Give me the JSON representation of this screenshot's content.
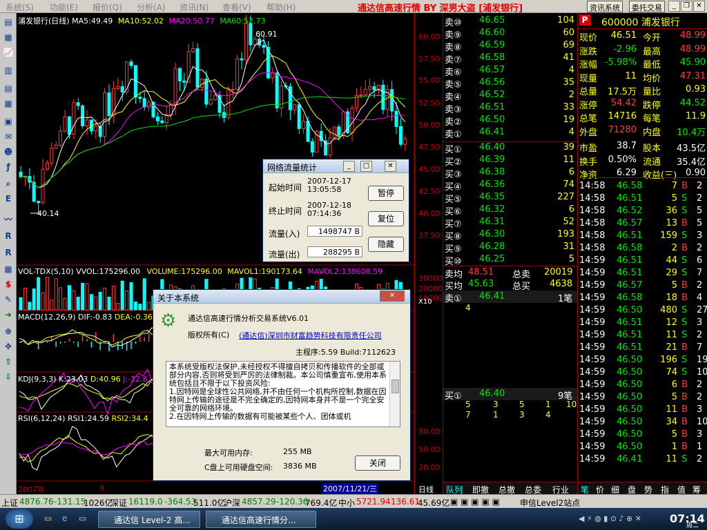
{
  "menu": {
    "items": [
      "系统(S)",
      "功能(E)",
      "报价(Q)",
      "分析(A)",
      "资讯(N)",
      "查看(V)",
      "帮助(H)"
    ],
    "app_title": "通达信高速行情 BY 深男大盗 [浦发银行]",
    "buttons": [
      "资讯系统",
      "委托交易"
    ]
  },
  "chart": {
    "header": {
      "name": "浦发银行(日线)",
      "ma5": "MA5:49.49",
      "ma10": "MA10:52.02",
      "ma20": "MA20:50.77",
      "ma60": "MA60:52.73"
    },
    "price_axis": [
      "60.00",
      "57.50",
      "55.00",
      "52.50",
      "50.00",
      "47.50",
      "45.00",
      "42.50",
      "40.00",
      "37.50"
    ],
    "high_label": "60.91",
    "low_label": "40.14",
    "vol_header": {
      "name": "VOL-TDX(5,10)",
      "vol": "VVOL:175296.00",
      "volume": "VOLUME:175296.00",
      "mavol1": "MAVOL1:190173.64",
      "mavol2": "MAVOL2:138608.59"
    },
    "vol_axis": [
      "30000",
      "20000",
      "10000"
    ],
    "vol_unit": "X10",
    "macd_header": {
      "name": "MACD(12,26,9)",
      "dif": "DIF:-0.83",
      "dea": "DEA:-0.36"
    },
    "kdj_header": {
      "name": "KDJ(9,3,3)",
      "k": "K:23.03",
      "d": "D:40.96",
      "j": "J:-12.8"
    },
    "rsi_header": {
      "name": "RSI(6,12,24)",
      "rsi1": "RSI1:24.59",
      "rsi2": "RSI2:34.4"
    },
    "rsi_axis": [
      "80.00",
      "50.00",
      "20.00"
    ],
    "date_axis": [
      "2007年",
      "9",
      "2007/11/21/三"
    ],
    "bottom_tab": "日线"
  },
  "quote": {
    "sells": [
      {
        "label": "卖⑩",
        "price": "46.65",
        "vol": "104"
      },
      {
        "label": "卖⑨",
        "price": "46.60",
        "vol": "60"
      },
      {
        "label": "卖⑧",
        "price": "46.59",
        "vol": "69"
      },
      {
        "label": "卖⑦",
        "price": "46.58",
        "vol": "41"
      },
      {
        "label": "卖⑥",
        "price": "46.57",
        "vol": "4"
      },
      {
        "label": "卖⑤",
        "price": "46.56",
        "vol": "35"
      },
      {
        "label": "卖④",
        "price": "46.52",
        "vol": "2"
      },
      {
        "label": "卖③",
        "price": "46.51",
        "vol": "33"
      },
      {
        "label": "卖②",
        "price": "46.50",
        "vol": "19"
      },
      {
        "label": "卖①",
        "price": "46.41",
        "vol": "4"
      }
    ],
    "buys": [
      {
        "label": "买①",
        "price": "46.40",
        "vol": "39"
      },
      {
        "label": "买②",
        "price": "46.39",
        "vol": "11"
      },
      {
        "label": "买③",
        "price": "46.38",
        "vol": "6"
      },
      {
        "label": "买④",
        "price": "46.36",
        "vol": "74"
      },
      {
        "label": "买⑤",
        "price": "46.35",
        "vol": "227"
      },
      {
        "label": "买⑥",
        "price": "46.32",
        "vol": "6"
      },
      {
        "label": "买⑦",
        "price": "46.31",
        "vol": "52"
      },
      {
        "label": "买⑧",
        "price": "46.30",
        "vol": "193"
      },
      {
        "label": "买⑨",
        "price": "46.28",
        "vol": "31"
      },
      {
        "label": "买⑩",
        "price": "46.25",
        "vol": "5"
      }
    ],
    "avg": [
      {
        "label": "卖均",
        "price": "48.51",
        "label2": "总卖",
        "val": "20019"
      },
      {
        "label": "买均",
        "price": "45.63",
        "label2": "总买",
        "val": "4638"
      }
    ],
    "sell1_detail": {
      "label": "卖①",
      "price": "46.41",
      "count": "1笔",
      "vols": [
        "4"
      ]
    },
    "buy1_detail": {
      "label": "买①",
      "price": "46.40",
      "count": "9笔",
      "row1": [
        "5",
        "3",
        "5",
        "1",
        "10"
      ],
      "row2": [
        "7",
        "1",
        "3",
        "4"
      ]
    },
    "tabs": [
      "队列",
      "即撤",
      "总撤",
      "总委",
      "行业"
    ]
  },
  "info": {
    "badge": "P",
    "code_name": "600000 浦发银行",
    "rows": [
      [
        "现价",
        "46.51",
        "今开",
        "48.99"
      ],
      [
        "涨跌",
        "-2.96",
        "最高",
        "48.99"
      ],
      [
        "涨幅",
        "-5.98%",
        "最低",
        "45.90"
      ],
      [
        "现量",
        "11",
        "均价",
        "47.31"
      ],
      [
        "总量",
        "17.5万",
        "量比",
        "0.93"
      ],
      [
        "涨停",
        "54.42",
        "跌停",
        "44.52"
      ],
      [
        "总笔",
        "14716",
        "每笔",
        "11.9"
      ],
      [
        "外盘",
        "71280",
        "内盘",
        "10.4万"
      ],
      [
        "市盈",
        "38.7",
        "股本",
        "43.5亿"
      ],
      [
        "换手",
        "0.50%",
        "流通",
        "35.4亿"
      ],
      [
        "净资",
        "6.29",
        "收益(三)",
        "0.90"
      ]
    ],
    "colors": [
      [
        "yel",
        "yel",
        "yel",
        "red"
      ],
      [
        "yel",
        "grn",
        "yel",
        "red"
      ],
      [
        "yel",
        "grn",
        "yel",
        "grn"
      ],
      [
        "yel",
        "yel",
        "yel",
        "red"
      ],
      [
        "yel",
        "yel",
        "yel",
        "yel"
      ],
      [
        "yel",
        "red",
        "yel",
        "grn"
      ],
      [
        "yel",
        "yel",
        "yel",
        "yel"
      ],
      [
        "yel",
        "red",
        "yel",
        "grn"
      ],
      [
        "yel",
        "wht",
        "yel",
        "wht"
      ],
      [
        "yel",
        "wht",
        "yel",
        "wht"
      ],
      [
        "yel",
        "wht",
        "yel",
        "wht"
      ]
    ],
    "tabs": [
      "笔",
      "价",
      "细",
      "盘",
      "势",
      "指",
      "值",
      "筹"
    ]
  },
  "ticks": [
    [
      "14:58",
      "46.58",
      "7",
      "B",
      "2"
    ],
    [
      "14:58",
      "46.51",
      "5",
      "S",
      "2"
    ],
    [
      "14:58",
      "46.52",
      "36",
      "S",
      "5"
    ],
    [
      "14:58",
      "46.57",
      "13",
      "B",
      "5"
    ],
    [
      "14:58",
      "46.51",
      "159",
      "S",
      "3"
    ],
    [
      "14:58",
      "46.58",
      "2",
      "B",
      "2"
    ],
    [
      "14:59",
      "46.51",
      "44",
      "S",
      "6"
    ],
    [
      "14:59",
      "46.51",
      "29",
      "S",
      "7"
    ],
    [
      "14:59",
      "46.57",
      "5",
      "B",
      "2"
    ],
    [
      "14:59",
      "46.58",
      "18",
      "B",
      "4"
    ],
    [
      "14:59",
      "46.50",
      "480",
      "S",
      "27"
    ],
    [
      "14:59",
      "46.51",
      "12",
      "S",
      "3"
    ],
    [
      "14:59",
      "46.51",
      "11",
      "S",
      "2"
    ],
    [
      "14:59",
      "46.51",
      "21",
      "B",
      "7"
    ],
    [
      "14:59",
      "46.50",
      "196",
      "S",
      "19"
    ],
    [
      "14:59",
      "46.50",
      "74",
      "S",
      "10"
    ],
    [
      "14:59",
      "46.50",
      "6",
      "B",
      "2"
    ],
    [
      "14:59",
      "46.50",
      "5",
      "B",
      "2"
    ],
    [
      "14:59",
      "46.50",
      "11",
      "B",
      "3"
    ],
    [
      "14:59",
      "46.50",
      "34",
      "B",
      "10"
    ],
    [
      "14:59",
      "46.50",
      "5",
      "B",
      "3"
    ],
    [
      "14:59",
      "46.50",
      "1",
      "B",
      "1"
    ],
    [
      "14:59",
      "46.41",
      "11",
      "S",
      "2"
    ]
  ],
  "traffic_dialog": {
    "title": "网络流量统计",
    "start_label": "起始时间",
    "start_value": "2007-12-17\n13:05:58",
    "end_label": "终止时间",
    "end_value": "2007-12-18\n07:14:36",
    "in_label": "流量(入)",
    "in_value": "1498747 B",
    "out_label": "流量(出)",
    "out_value": "288295 B",
    "btn_pause": "暂停",
    "btn_reset": "复位",
    "btn_hide": "隐藏"
  },
  "about_dialog": {
    "title": "关于本系统",
    "product": "通达信高速行情分析交易系统V6.01",
    "copyright": "版权所有(C)",
    "company": "(通达信)深圳市财富趋势科技有限责任公司",
    "version": "主程序:5.59 Build:7112623",
    "notice": "本系统受版权法保护,未经授权不得擅自拷贝和传播软件的全部或部分内容,否则将受到严厉的法律制裁。本公司慎重宣布,使用本系统包括且不限于以下投资风险:\n1.因特网是全球性公共网络,并不由任何一个机构所控制,数据在因特网上传输的途径是不完全确定的,因特网本身并不是一个完全安全可靠的网络环境。\n2.在因特网上传输的数据有可能被某些个人、团体或机",
    "mem_label": "最大可用内存:",
    "mem_value": "255 MB",
    "disk_label": "C盘上可用硬盘空间:",
    "disk_value": "3836 MB",
    "close": "关闭"
  },
  "statusbar": {
    "sh": {
      "name": "上证",
      "value": "4876.76",
      "chg": "-131.15",
      "amt": "1026亿"
    },
    "sz": {
      "name": "深证",
      "value": "16119.0",
      "chg": "-364.53",
      "amt": "511.0亿"
    },
    "hs": {
      "name": "沪深",
      "value": "4857.29",
      "chg": "-120.36",
      "amt": "769.4亿"
    },
    "zx": {
      "name": "中小",
      "value": "5721.94",
      "chg": "136.61",
      "amt": "45.69亿"
    },
    "level2": "申信Level2站点"
  },
  "taskbar": {
    "tasks": [
      "通达信 Level-2 高...",
      "通达信高速行情分..."
    ],
    "time": "07:14",
    "day": "周二"
  }
}
